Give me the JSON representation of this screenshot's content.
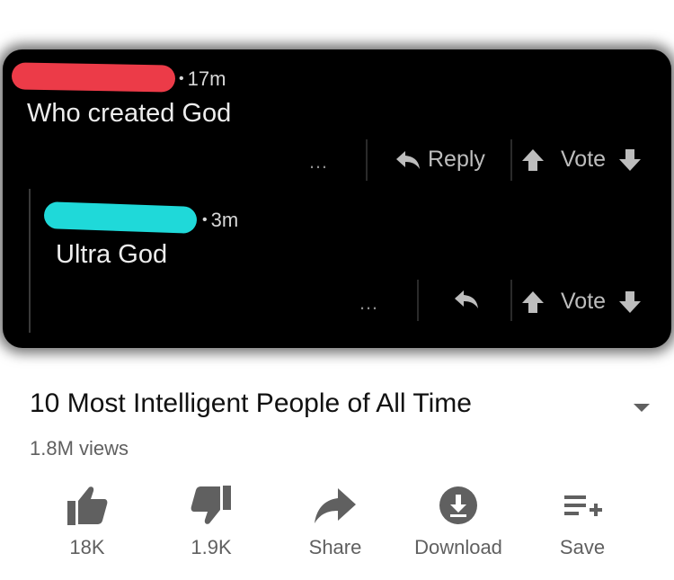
{
  "comments": [
    {
      "time": "17m",
      "text": "Who created God",
      "more": "…",
      "reply_label": "Reply",
      "vote_label": "Vote"
    },
    {
      "time": "3m",
      "text": "Ultra God",
      "more": "…",
      "vote_label": "Vote"
    }
  ],
  "video": {
    "title": "10 Most Intelligent People of All Time",
    "views": "1.8M views"
  },
  "actions": {
    "like": "18K",
    "dislike": "1.9K",
    "share": "Share",
    "download": "Download",
    "save": "Save"
  },
  "colors": {
    "redaction_1": "#ec3b48",
    "redaction_2": "#1fd9d9",
    "icon": "#606060"
  }
}
